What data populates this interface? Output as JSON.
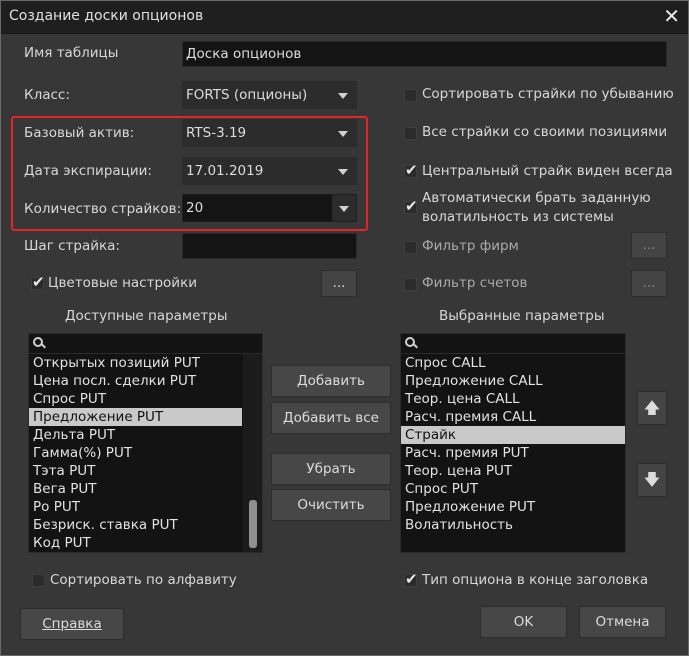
{
  "window": {
    "title": "Создание доски опционов"
  },
  "form": {
    "table_name_label": "Имя таблицы",
    "table_name_value": "Доска опционов",
    "class_label": "Класс:",
    "class_value": "FORTS (опционы)",
    "base_asset_label": "Базовый актив:",
    "base_asset_value": "RTS-3.19",
    "expiry_label": "Дата экспирации:",
    "expiry_value": "17.01.2019",
    "strikes_count_label": "Количество страйков:",
    "strikes_count_value": "20",
    "strike_step_label": "Шаг страйка:",
    "strike_step_value": "",
    "color_settings_label": "Цветовые настройки",
    "ellipsis": "..."
  },
  "options": {
    "sort_desc": {
      "label": "Сортировать страйки по убыванию",
      "checked": false
    },
    "all_strikes_with_positions": {
      "label": "Все страйки со своими позициями",
      "checked": false
    },
    "central_strike_visible": {
      "label": "Центральный страйк виден всегда",
      "checked": true
    },
    "auto_volatility_line1": "Автоматически брать заданную",
    "auto_volatility_line2": "волатильность из системы",
    "auto_volatility_checked": true,
    "firm_filter": {
      "label": "Фильтр фирм",
      "checked": false
    },
    "account_filter": {
      "label": "Фильтр счетов",
      "checked": false
    },
    "color_settings_checked": true
  },
  "available": {
    "header": "Доступные параметры",
    "items": [
      "Открытых позиций PUT",
      "Цена посл. сделки PUT",
      "Спрос PUT",
      "Предложение PUT",
      "Дельта PUT",
      "Гамма(%) PUT",
      "Тэта PUT",
      "Вега PUT",
      "Ро PUT",
      "Безриск. ставка PUT",
      "Код PUT"
    ],
    "selected_index": 3,
    "sort_alpha_label": "Сортировать по алфавиту",
    "sort_alpha_checked": false
  },
  "selected": {
    "header": "Выбранные параметры",
    "items": [
      "Спрос CALL",
      "Предложение CALL",
      "Теор. цена CALL",
      "Расч. премия CALL",
      "Страйк",
      "Расч. премия PUT",
      "Теор. цена PUT",
      "Спрос PUT",
      "Предложение PUT",
      "Волатильность"
    ],
    "selected_index": 4,
    "option_type_label": "Тип опциона в конце заголовка",
    "option_type_checked": true
  },
  "buttons": {
    "add": "Добавить",
    "add_all": "Добавить все",
    "remove": "Убрать",
    "clear": "Очистить",
    "help": "Справка",
    "ok": "OK",
    "cancel": "Отмена"
  }
}
